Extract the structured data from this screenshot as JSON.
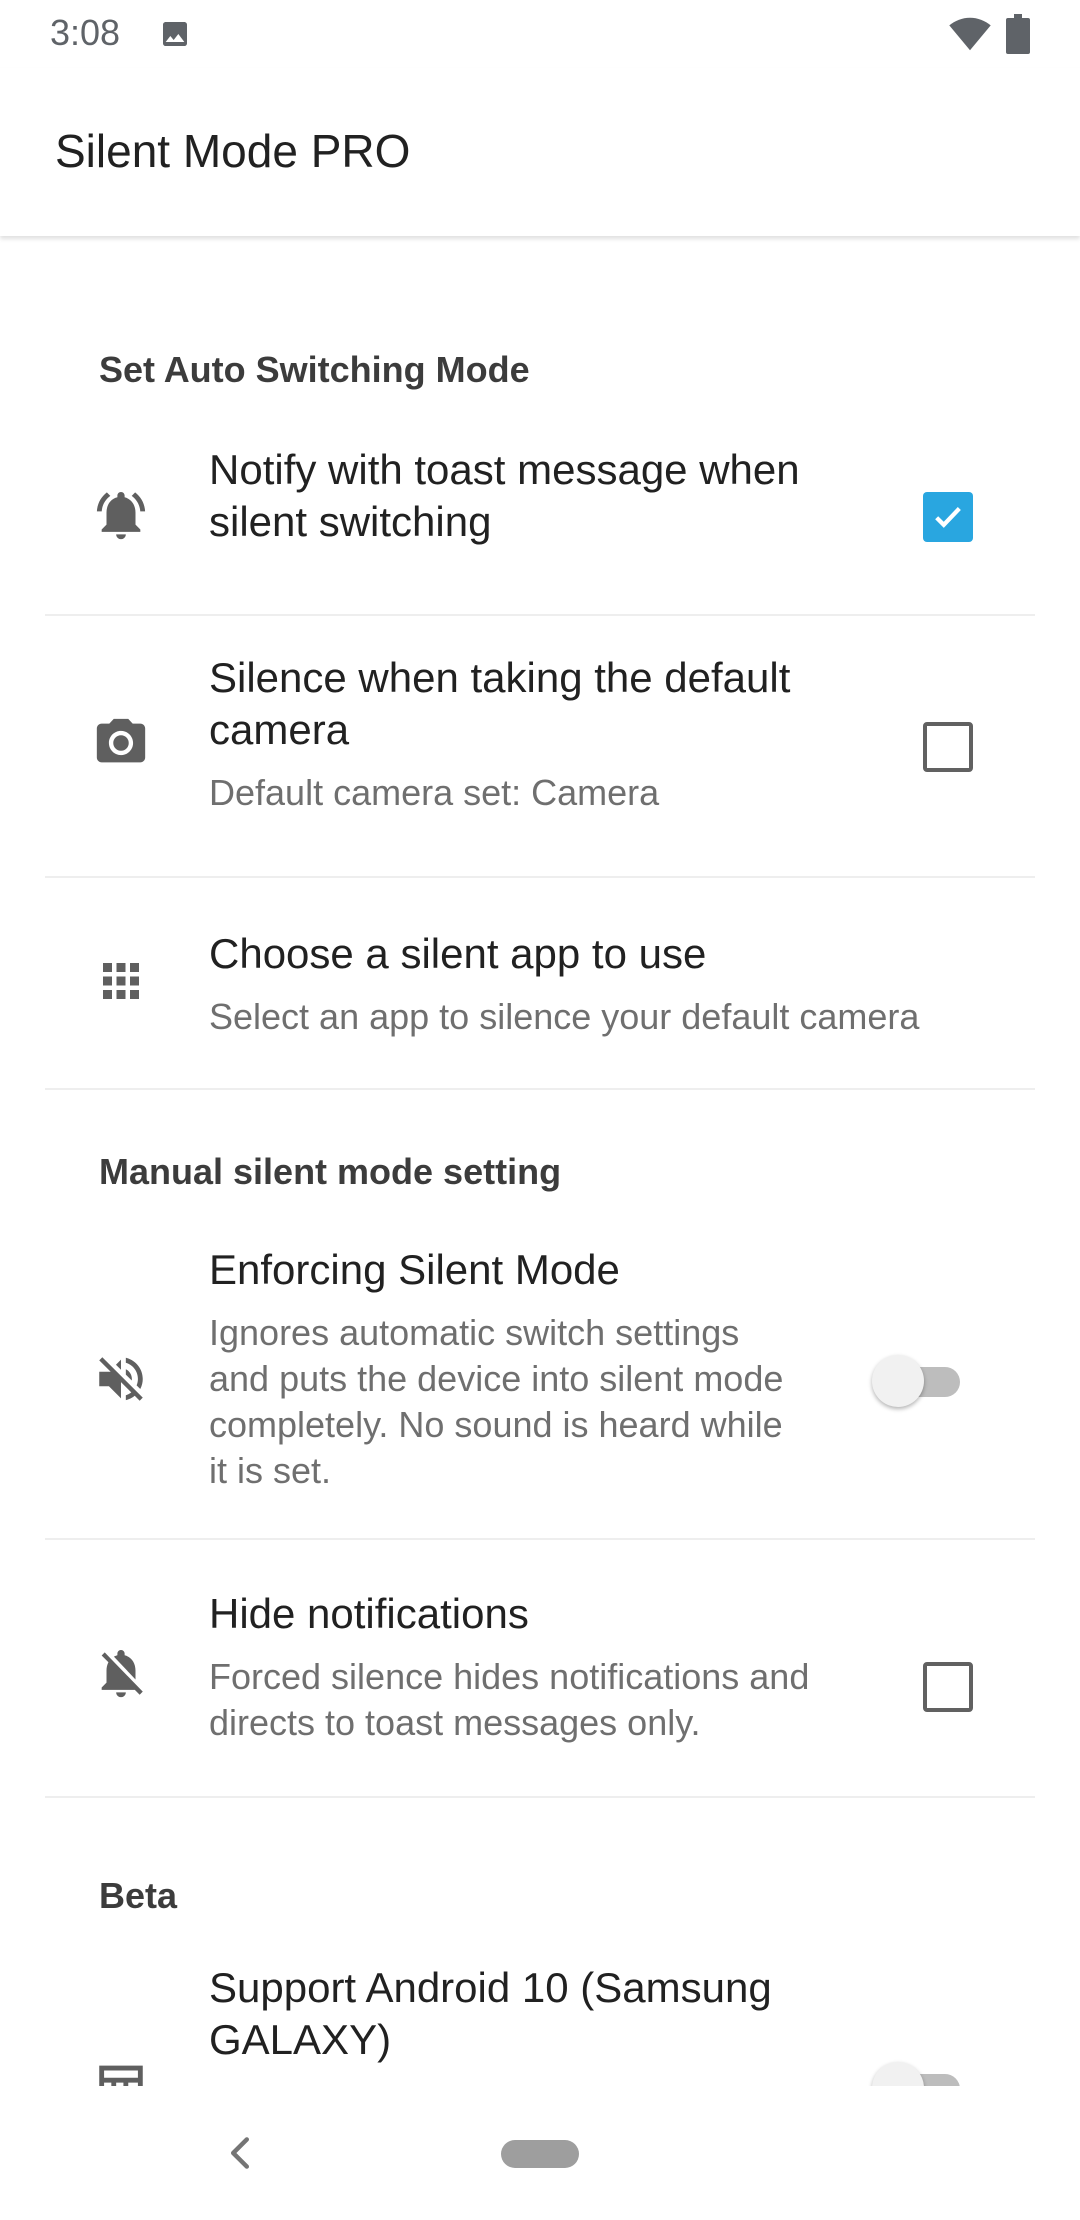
{
  "status_bar": {
    "time": "3:08",
    "icons": [
      "image-icon",
      "wifi-icon",
      "battery-icon"
    ]
  },
  "app_bar": {
    "title": "Silent Mode PRO"
  },
  "sections": {
    "auto": {
      "header": "Set Auto Switching Mode",
      "items": [
        {
          "icon": "bell-ringing-icon",
          "title_line1": "Notify with toast message when",
          "title_line2": "silent switching",
          "control": "checkbox",
          "checked": true
        },
        {
          "icon": "camera-icon",
          "title_line1": "Silence when taking the default",
          "title_line2": "camera",
          "summary": "Default camera set: Camera",
          "control": "checkbox",
          "checked": false
        },
        {
          "icon": "apps-grid-icon",
          "title_line1": "Choose a silent app to use",
          "summary": "Select an app to silence your default camera"
        }
      ]
    },
    "manual": {
      "header": "Manual silent mode setting",
      "items": [
        {
          "icon": "volume-off-icon",
          "title_line1": "Enforcing Silent Mode",
          "summary_line1": "Ignores automatic switch settings",
          "summary_line2": "and puts the device into silent mode",
          "summary_line3": "completely. No sound is heard while",
          "summary_line4": "it is set.",
          "control": "switch",
          "on": false
        },
        {
          "icon": "bell-off-icon",
          "title_line1": "Hide notifications",
          "summary_line1": "Forced silence hides notifications and",
          "summary_line2": "directs to toast messages only.",
          "control": "checkbox",
          "checked": false
        }
      ]
    },
    "beta": {
      "header": "Beta",
      "items": [
        {
          "icon": "device-icon",
          "title_line1": "Support Android 10 (Samsung",
          "title_line2": "GALAXY)",
          "control": "switch",
          "on": false
        }
      ]
    }
  },
  "colors": {
    "accent": "#29a6e0",
    "divider": "#eeeeee",
    "icon": "#5f5f5f"
  },
  "nav_bar": {
    "icons": [
      "back-icon",
      "home-pill"
    ]
  }
}
